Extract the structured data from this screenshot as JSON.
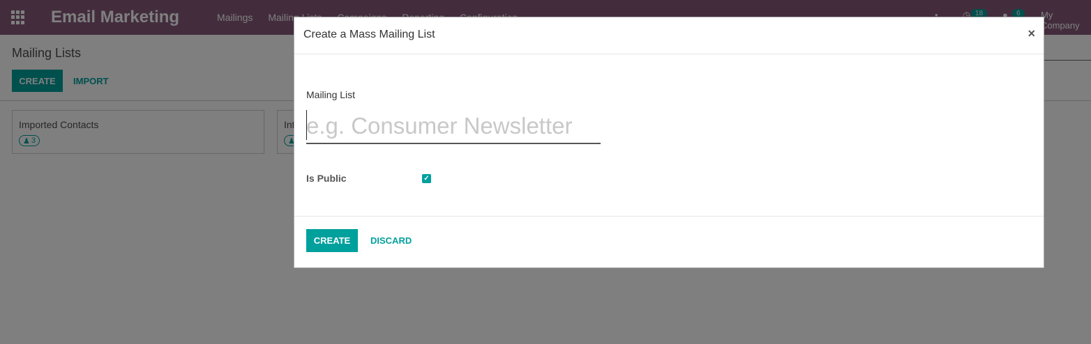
{
  "navbar": {
    "app_title": "Email Marketing",
    "menu": [
      "Mailings",
      "Mailing Lists",
      "Campaigns",
      "Reporting",
      "Configuration"
    ],
    "activity_count": "18",
    "message_count": "6",
    "company": "My Company"
  },
  "control_panel": {
    "breadcrumb": "Mailing Lists",
    "create_label": "CREATE",
    "import_label": "IMPORT"
  },
  "kanban": [
    {
      "title": "Imported Contacts",
      "count": "3"
    },
    {
      "title": "Int"
    }
  ],
  "dialog": {
    "title": "Create a Mass Mailing List",
    "close": "×",
    "field_label": "Mailing List",
    "name_placeholder": "e.g. Consumer Newsletter",
    "name_value": "",
    "public_label": "Is Public",
    "public_checked": true,
    "create_label": "CREATE",
    "discard_label": "DISCARD"
  },
  "colors": {
    "navbar": "#875a7b",
    "accent": "#00a09d"
  }
}
